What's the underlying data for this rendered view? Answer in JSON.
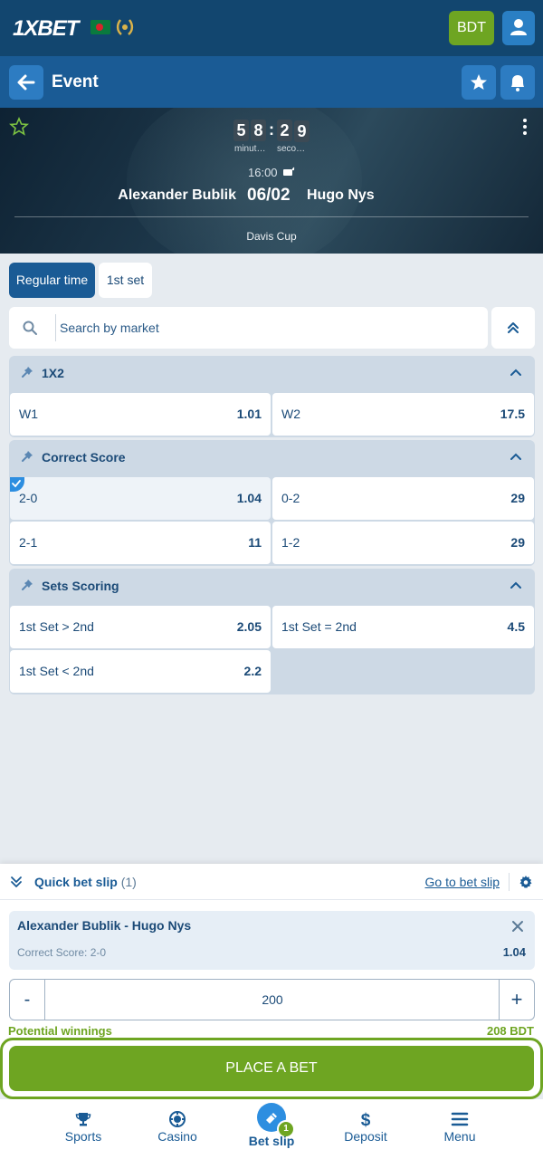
{
  "brand": {
    "logo_text": "1XBET",
    "currency_button": "BDT"
  },
  "header": {
    "title": "Event"
  },
  "scoreboard": {
    "timer_digits": [
      "5",
      "8",
      "2",
      "9"
    ],
    "timer_labels": [
      "minut…",
      "seco…"
    ],
    "start_time": "16:00",
    "team1": "Alexander Bublik",
    "date": "06/02",
    "team2": "Hugo Nys",
    "league": "Davis Cup"
  },
  "tabs": [
    {
      "label": "Regular time",
      "active": true
    },
    {
      "label": "1st set",
      "active": false
    }
  ],
  "search": {
    "placeholder": "Search by market"
  },
  "markets": [
    {
      "title": "1X2",
      "outcomes": [
        {
          "label": "W1",
          "odd": "1.01"
        },
        {
          "label": "W2",
          "odd": "17.5"
        }
      ]
    },
    {
      "title": "Correct Score",
      "outcomes": [
        {
          "label": "2-0",
          "odd": "1.04",
          "selected": true
        },
        {
          "label": "0-2",
          "odd": "29"
        },
        {
          "label": "2-1",
          "odd": "11"
        },
        {
          "label": "1-2",
          "odd": "29"
        }
      ]
    },
    {
      "title": "Sets Scoring",
      "outcomes": [
        {
          "label": "1st Set > 2nd",
          "odd": "2.05"
        },
        {
          "label": "1st Set = 2nd",
          "odd": "4.5"
        },
        {
          "label": "1st Set < 2nd",
          "odd": "2.2"
        }
      ]
    }
  ],
  "quick_slip": {
    "title": "Quick bet slip",
    "count": "(1)",
    "go_to_label": "Go to bet slip",
    "bet": {
      "match": "Alexander Bublik - Hugo Nys",
      "market": "Correct Score: 2-0",
      "odd": "1.04"
    },
    "stake_minus": "-",
    "stake_value": "200",
    "stake_plus": "+",
    "potential_label": "Potential winnings",
    "potential_value": "208 BDT"
  },
  "place_bet_label": "PLACE A BET",
  "bottom_nav": [
    {
      "label": "Sports",
      "icon": "trophy-icon"
    },
    {
      "label": "Casino",
      "icon": "chip-icon"
    },
    {
      "label": "Bet slip",
      "icon": "ticket-icon",
      "badge": "1",
      "active": true
    },
    {
      "label": "Deposit",
      "icon": "dollar-icon"
    },
    {
      "label": "Menu",
      "icon": "hamburger-icon"
    }
  ],
  "colors": {
    "brand_dark": "#12466f",
    "brand_blue": "#1a5b95",
    "accent_green": "#6ea522",
    "market_header": "#cdd9e5"
  }
}
